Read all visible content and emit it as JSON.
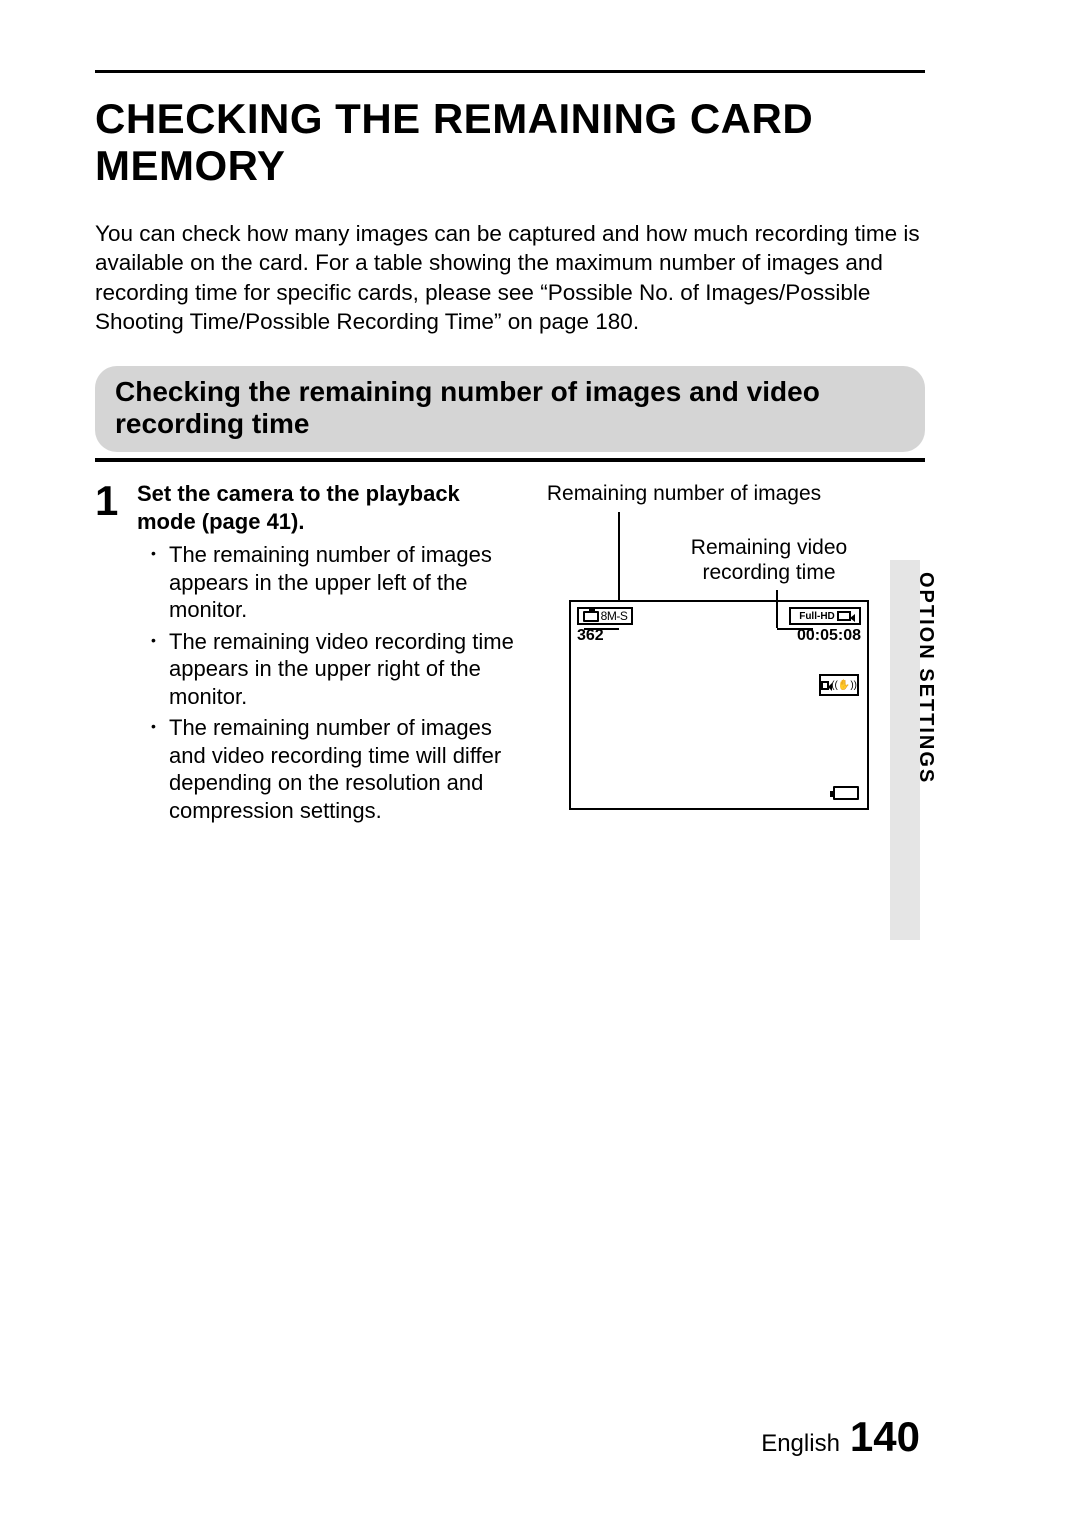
{
  "title": "CHECKING THE REMAINING CARD MEMORY",
  "intro": "You can check how many images can be captured and how much recording time is available on the card. For a table showing the maximum number of images and recording time for specific cards, please see “Possible No. of Images/Possible Shooting Time/Possible Recording Time” on page 180.",
  "section_heading": "Checking the remaining number of images and video recording time",
  "step": {
    "number": "1",
    "heading": "Set the camera to the playback mode (page 41).",
    "bullets": [
      "The remaining number of images appears in the upper left of the monitor.",
      "The remaining video recording time appears in the upper right of the monitor.",
      "The remaining number of images and video recording time will differ depending on the resolution and compression settings."
    ]
  },
  "diagram": {
    "label_images": "Remaining number of images",
    "label_video": "Remaining video recording time",
    "photo_mode": "8M-S",
    "images_remaining": "362",
    "video_mode": "Full-HD",
    "video_time": "00:05:08"
  },
  "side_label": "OPTION SETTINGS",
  "footer": {
    "lang": "English",
    "page": "140"
  }
}
